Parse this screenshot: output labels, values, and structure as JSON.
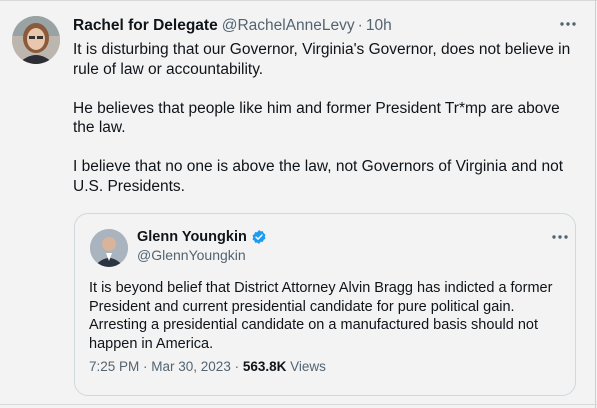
{
  "tweet": {
    "author_name": "Rachel for Delegate",
    "handle": "@RachelAnneLevy",
    "separator": "·",
    "time": "10h",
    "paragraphs": [
      "It is disturbing that our Governor, Virginia's Governor, does not believe in rule of law or accountability.",
      "He believes that people like him and former President Tr*mp are above the law.",
      "I believe that no one is above the law, not Governors of Virginia and not U.S. Presidents."
    ]
  },
  "quoted_tweet": {
    "author_name": "Glenn Youngkin",
    "handle": "@GlennYoungkin",
    "text": "It is beyond belief that District Attorney Alvin Bragg has indicted a former President and current presidential candidate for pure political gain. Arresting a presidential candidate on a manufactured basis should not happen in America.",
    "timestamp": "7:25 PM · Mar 30, 2023 ·",
    "views_count": "563.8K",
    "views_label": "Views"
  },
  "icons": {
    "more": "more-horizontal-icon",
    "verified": "verified-badge-icon"
  },
  "colors": {
    "background": "#f3f3f3",
    "text": "#0f1419",
    "secondary_text": "#536471",
    "verified_blue": "#1d9bf0",
    "border": "#cfd9de"
  }
}
